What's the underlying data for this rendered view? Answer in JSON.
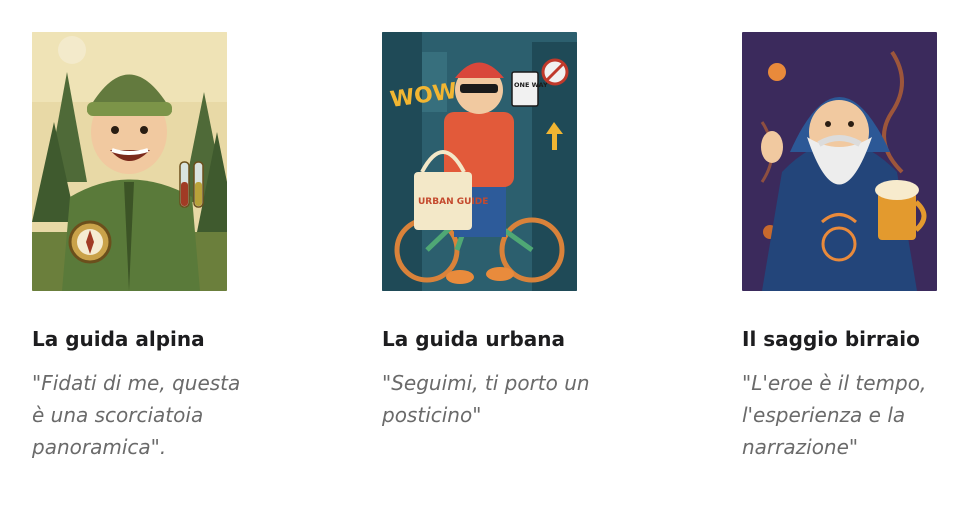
{
  "guides": [
    {
      "name": "La guida alpina",
      "quote": "\"Fidati di me, questa è una scorciatoia panoramica\".",
      "image_icon": "alpine-guide-illustration"
    },
    {
      "name": "La guida urbana",
      "quote": "\"Seguimi, ti porto un posticino\"",
      "image_icon": "urban-guide-illustration",
      "image_text": {
        "wall": "WOW",
        "sign": "ONE WAY",
        "bag": "URBAN GUIDE"
      }
    },
    {
      "name": "Il saggio birraio",
      "quote": "\"L'eroe è il tempo, l'esperienza e la narrazione\"",
      "image_icon": "wise-brewer-illustration"
    }
  ],
  "colors": {
    "title": "#1d1d1f",
    "quote": "#6a6a6a",
    "alpine_bg": "#e8d9a6",
    "urban_bg": "#2c5f6e",
    "brewer_bg": "#3b2a5c"
  }
}
